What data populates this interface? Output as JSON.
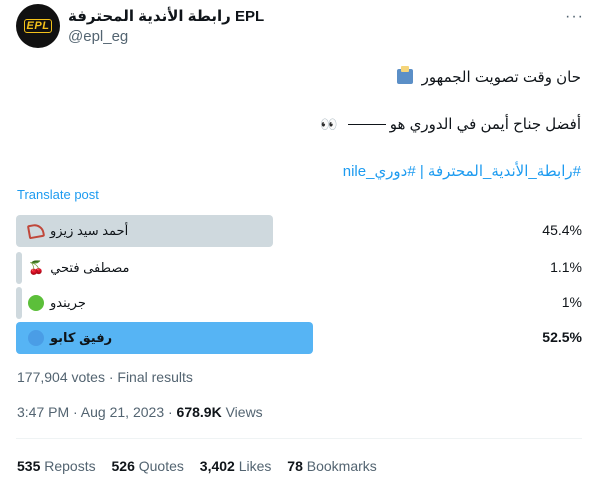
{
  "tweet": {
    "author_name": "رابطة الأندية المحترفة EPL",
    "handle": "@epl_eg",
    "avatar_text": "EPL",
    "more_icon": "more-icon",
    "line1": "حان وقت تصويت الجمهور",
    "line2_before": "أفضل جناح أيمن في الدوري هو",
    "line2_emoji": "👀",
    "hashtags": "#رابطة_الأندية_المحترفة | #دوري_nile",
    "translate_label": "Translate post"
  },
  "poll": {
    "options": [
      {
        "label": "أحمد سيد زيزو",
        "percent": "45.4%",
        "fraction": 0.454,
        "icon": "bow-icon",
        "winner": false
      },
      {
        "label": "مصطفى فتحي",
        "percent": "1.1%",
        "fraction": 0.011,
        "icon": "cherries-icon",
        "winner": false
      },
      {
        "label": "جريندو",
        "percent": "1%",
        "fraction": 0.01,
        "icon": "green-circle-icon",
        "winner": false
      },
      {
        "label": "رفيق كابو",
        "percent": "52.5%",
        "fraction": 0.525,
        "icon": "blue-circle-icon",
        "winner": true
      }
    ],
    "votes_text": "177,904 votes · Final results"
  },
  "meta": {
    "time_date": "3:47 PM · Aug 21, 2023 · ",
    "views_count": "678.9K",
    "views_label": "Views"
  },
  "stats": {
    "reposts_count": "535",
    "reposts_label": "Reposts",
    "quotes_count": "526",
    "quotes_label": "Quotes",
    "likes_count": "3,402",
    "likes_label": "Likes",
    "bookmarks_count": "78",
    "bookmarks_label": "Bookmarks"
  },
  "colors": {
    "accent": "#1d9bf0",
    "bar": "#cfd9de",
    "muted": "#536471"
  }
}
